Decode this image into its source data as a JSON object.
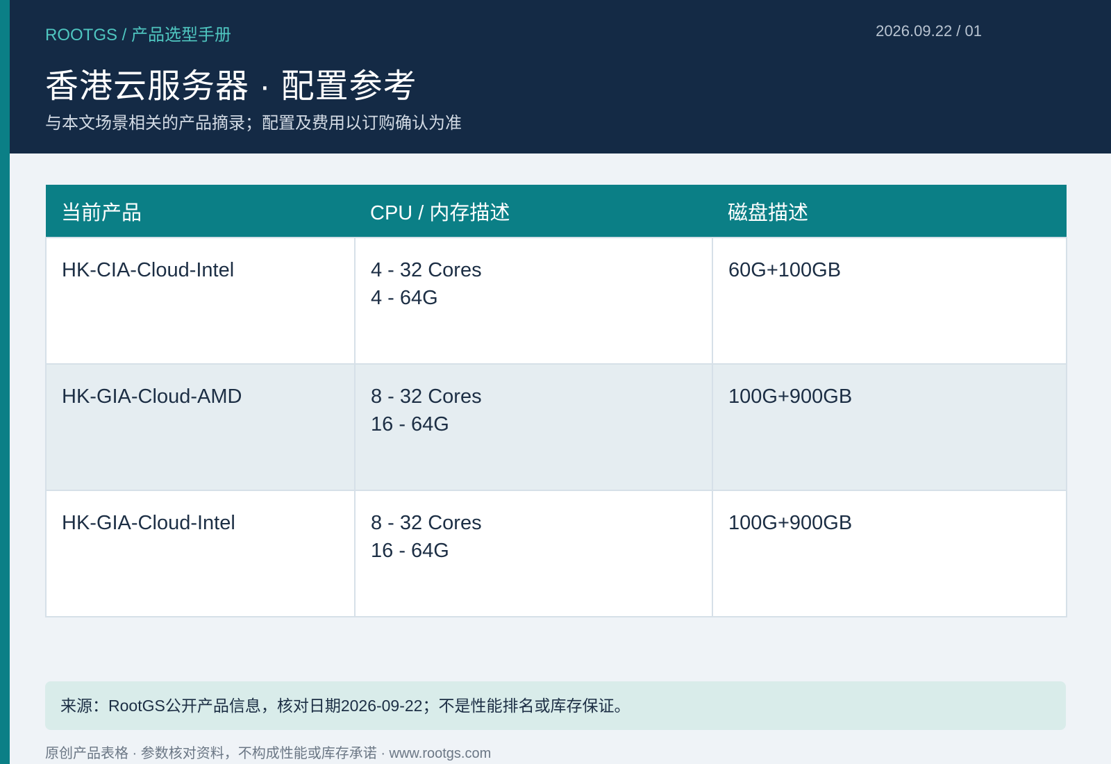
{
  "header": {
    "breadcrumb": "ROOTGS / 产品选型手册",
    "doc_id": "2026.09.22 / 01",
    "title": "香港云服务器 · 配置参考",
    "subtitle": "与本文场景相关的产品摘录；配置及费用以订购确认为准"
  },
  "table": {
    "headers": [
      "当前产品",
      "CPU / 内存描述",
      "磁盘描述"
    ],
    "rows": [
      {
        "product": "HK-CIA-Cloud-Intel",
        "cpu": "4 - 32 Cores",
        "memory": "4 - 64G",
        "disk": "60G+100GB"
      },
      {
        "product": "HK-GIA-Cloud-AMD",
        "cpu": "8 - 32 Cores",
        "memory": "16 - 64G",
        "disk": "100G+900GB"
      },
      {
        "product": "HK-GIA-Cloud-Intel",
        "cpu": "8 - 32 Cores",
        "memory": "16 - 64G",
        "disk": "100G+900GB"
      }
    ]
  },
  "source_note": "来源：RootGS公开产品信息，核对日期2026-09-22；不是性能排名或库存保证。",
  "footer": "原创产品表格 · 参数核对资料，不构成性能或库存承诺 · www.rootgs.com",
  "colors": {
    "header_bg": "#142a45",
    "accent": "#0b7f86",
    "breadcrumb": "#4fc6c0",
    "note_bg": "#d9ecea",
    "page_bg": "#eff3f7"
  }
}
